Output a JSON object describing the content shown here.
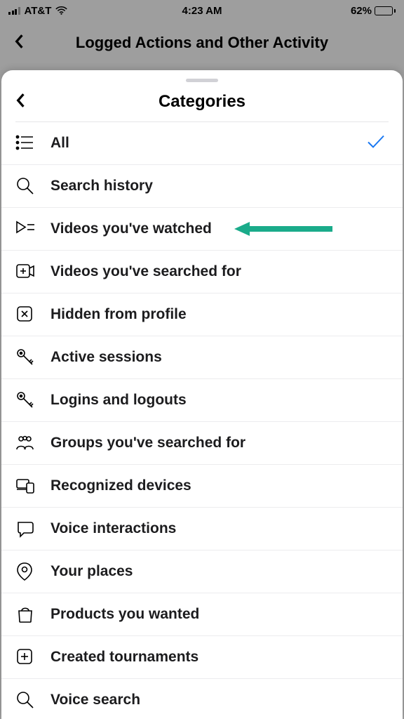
{
  "status": {
    "carrier": "AT&T",
    "time": "4:23 AM",
    "battery_pct": "62%"
  },
  "parent_header": {
    "title": "Logged Actions and Other Activity"
  },
  "sheet": {
    "title": "Categories"
  },
  "categories": {
    "selected_index": 0,
    "annotation_index": 2,
    "items": [
      {
        "id": "all",
        "label": "All",
        "icon": "list-icon"
      },
      {
        "id": "search-history",
        "label": "Search history",
        "icon": "search-icon"
      },
      {
        "id": "videos-watched",
        "label": "Videos you've watched",
        "icon": "play-list-icon"
      },
      {
        "id": "videos-searched",
        "label": "Videos you've searched for",
        "icon": "add-video-icon"
      },
      {
        "id": "hidden-profile",
        "label": "Hidden from profile",
        "icon": "x-box-icon"
      },
      {
        "id": "active-sessions",
        "label": "Active sessions",
        "icon": "key-icon"
      },
      {
        "id": "logins-logouts",
        "label": "Logins and logouts",
        "icon": "key-icon"
      },
      {
        "id": "groups-searched",
        "label": "Groups you've searched for",
        "icon": "people-icon"
      },
      {
        "id": "recognized-devices",
        "label": "Recognized devices",
        "icon": "devices-icon"
      },
      {
        "id": "voice-interactions",
        "label": "Voice interactions",
        "icon": "chat-bubble-icon"
      },
      {
        "id": "your-places",
        "label": "Your places",
        "icon": "pin-icon"
      },
      {
        "id": "products-wanted",
        "label": "Products you wanted",
        "icon": "bag-icon"
      },
      {
        "id": "created-tournaments",
        "label": "Created tournaments",
        "icon": "add-box-icon"
      },
      {
        "id": "voice-search",
        "label": "Voice search",
        "icon": "search-icon"
      }
    ]
  },
  "colors": {
    "accent": "#1877f2",
    "annotation": "#1aab8a"
  }
}
